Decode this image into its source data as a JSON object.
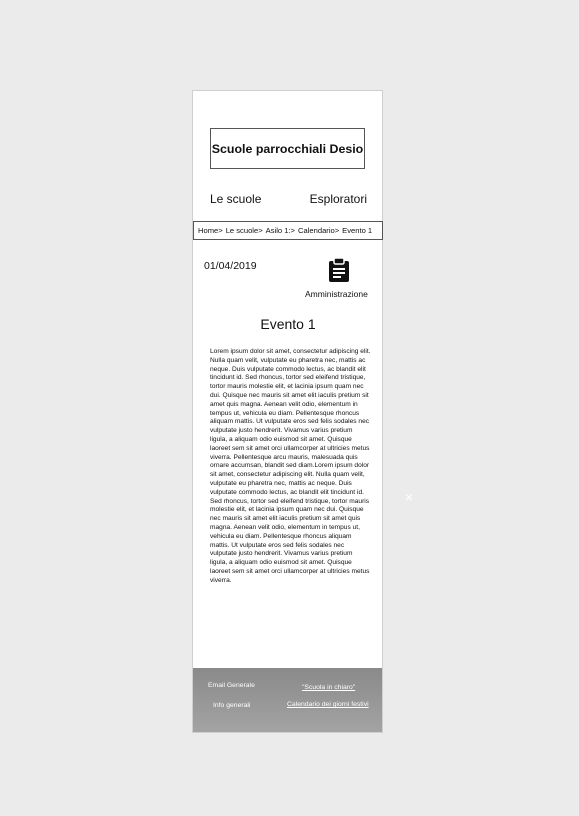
{
  "header": {
    "title": "Scuole parrocchiali Desio"
  },
  "nav": {
    "left": "Le scuole",
    "right": "Esploratori"
  },
  "breadcrumb": [
    "Home>",
    "Le scuole>",
    "Asilo 1:>",
    "Calendario>",
    "Evento 1"
  ],
  "event": {
    "date": "01/04/2019",
    "admin_label": "Amministrazione",
    "admin_icon": "clipboard-icon",
    "title": "Evento 1",
    "body": "Lorem ipsum dolor sit amet, consectetur adipiscing elit. Nulla quam velit, vulputate eu pharetra nec, mattis ac neque. Duis vulputate commodo lectus, ac blandit elit tincidunt id. Sed rhoncus, tortor sed eleifend tristique, tortor mauris molestie elit, et lacinia ipsum quam nec dui. Quisque nec mauris sit amet elit iaculis pretium sit amet quis magna. Aenean velit odio, elementum in tempus ut, vehicula eu diam. Pellentesque rhoncus aliquam mattis. Ut vulputate eros sed felis sodales nec vulputate justo hendrerit. Vivamus varius pretium ligula, a aliquam odio euismod sit amet. Quisque laoreet sem sit amet orci ullamcorper at ultricies metus viverra. Pellentesque arcu mauris, malesuada quis ornare accumsan, blandit sed diam.Lorem ipsum dolor sit amet, consectetur adipiscing elit. Nulla quam  velit, vulputate eu pharetra nec, mattis ac neque. Duis vulputate  commodo lectus, ac blandit elit tincidunt id. Sed rhoncus, tortor sed  eleifend tristique, tortor mauris molestie elit, et lacinia ipsum quam  nec dui. Quisque nec mauris sit amet elit iaculis pretium sit amet quis  magna. Aenean velit odio, elementum in tempus ut, vehicula eu diam.  Pellentesque rhoncus aliquam mattis. Ut vulputate eros sed felis sodales  nec vulputate justo hendrerit. Vivamus varius pretium ligula, a aliquam  odio euismod sit amet. Quisque laoreet sem sit amet orci ullamcorper at  ultricies metus viverra."
  },
  "footer": {
    "email": "Email Generale",
    "info": "Info generali",
    "scuola": "\"Scuola in chiaro\"",
    "calendario": "Calendario dei giorni festivi"
  },
  "overlay": {
    "close_glyph": "×",
    "close_icon": "close-icon"
  },
  "colors": {
    "background": "#ebebeb",
    "footer": "#999999",
    "text": "#111111"
  }
}
